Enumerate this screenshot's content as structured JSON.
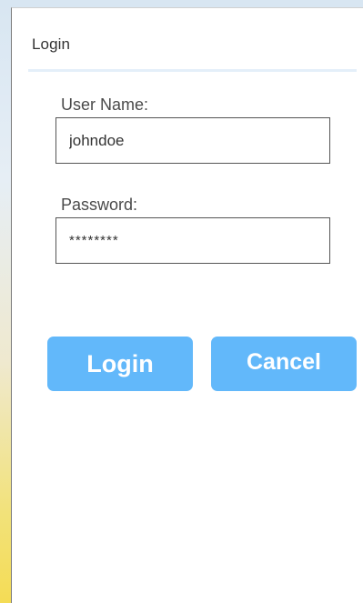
{
  "dialog": {
    "title": "Login"
  },
  "form": {
    "username_label": "User Name:",
    "username_value": "johndoe",
    "password_label": "Password:",
    "password_value": "********"
  },
  "buttons": {
    "login_label": "Login",
    "cancel_label": "Cancel"
  },
  "colors": {
    "button_bg": "#62b8fa",
    "button_text": "#ffffff",
    "title_rule": "#e4eff9"
  }
}
